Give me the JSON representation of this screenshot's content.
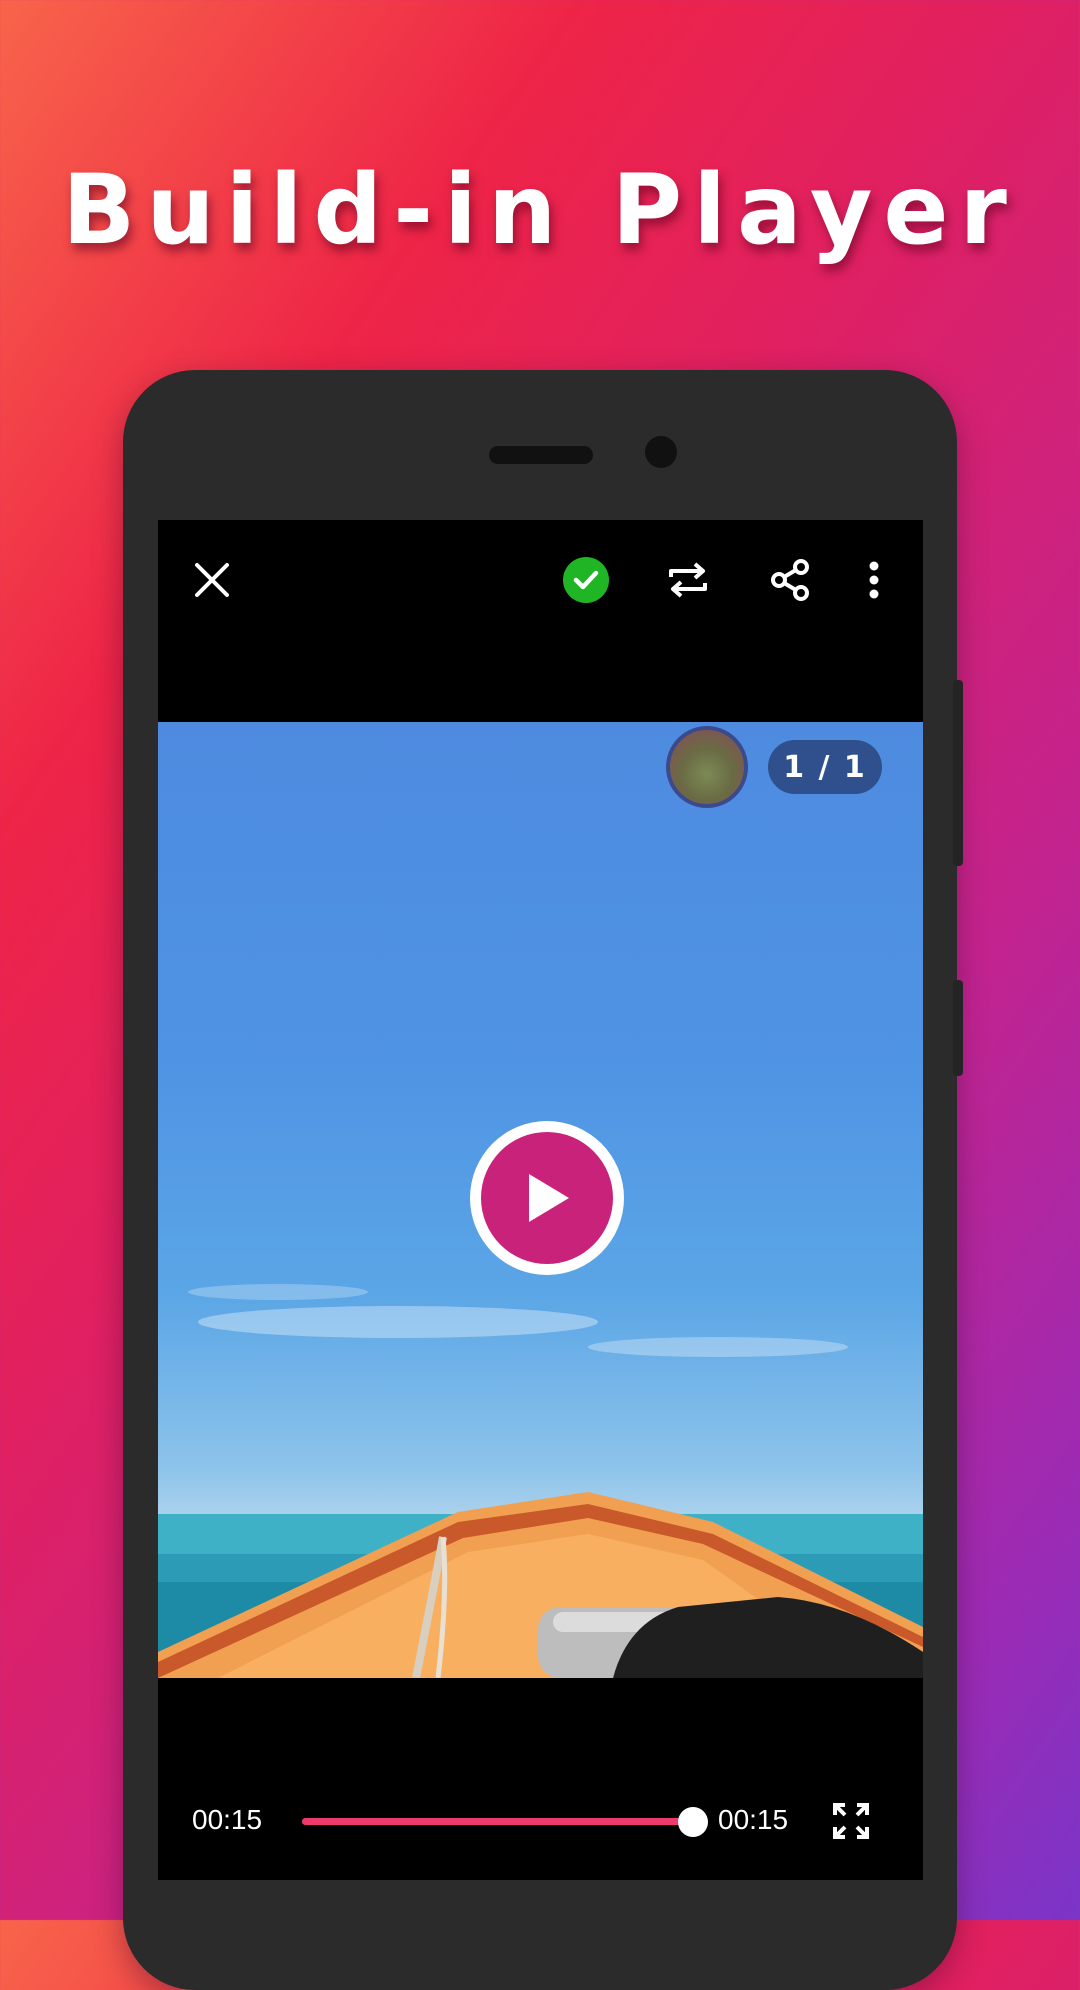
{
  "promo": {
    "headline": "Build-in Player"
  },
  "player": {
    "toolbar": {
      "close": "close-icon",
      "verified": "check-circle-icon",
      "repost": "repeat-icon",
      "share": "share-icon",
      "more": "more-vertical-icon"
    },
    "media_counter": "1 / 1",
    "playback": {
      "elapsed": "00:15",
      "duration": "00:15",
      "progress_fraction": 1.0,
      "fullscreen": "fullscreen-icon"
    },
    "colors": {
      "accent": "#c9227a",
      "seekbar": "#ee3b6b",
      "verified": "#1fb525"
    }
  }
}
